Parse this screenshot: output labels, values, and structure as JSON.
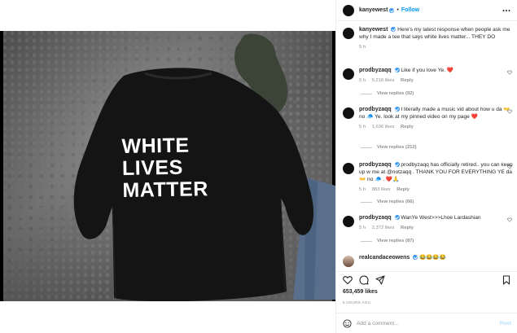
{
  "header": {
    "username": "kanyewest",
    "separator": "•",
    "follow_label": "Follow"
  },
  "shirt_print": [
    "WHITE",
    "LIVES",
    "MATTER"
  ],
  "caption": {
    "username": "kanyewest",
    "text": "Here's my latest response when people ask me why I made a tee that says white lives matter... THEY DO",
    "time": "5 h"
  },
  "comments": [
    {
      "username": "prodbyzaqq",
      "text": "Like if you love Ye. ❤️",
      "time": "5 h",
      "likes": "5,216 likes",
      "reply_label": "Reply",
      "view_replies": "View replies (92)"
    },
    {
      "username": "prodbyzaqq",
      "text": "I literally made a music vid about how u da 👐 no 🧢 Ye. look at my pinned video on my page ❤️",
      "time": "5 h",
      "likes": "1,636 likes",
      "reply_label": "Reply",
      "view_replies": "View replies (212)"
    },
    {
      "username": "prodbyzaqq",
      "text": "prodbyzaqq has officially retired.. you can keep up w me at @notzaqq . THANK YOU FOR EVERYTHING YE da 👐 no 🧢 . ❤️🙏",
      "time": "5 h",
      "likes": "883 likes",
      "reply_label": "Reply",
      "view_replies": "View replies (66)"
    },
    {
      "username": "prodbyzaqq",
      "text": "WanYe West>>>Lhoe Lardashian",
      "time": "5 h",
      "likes": "2,372 likes",
      "reply_label": "Reply",
      "view_replies": "View replies (87)"
    },
    {
      "username": "realcandaceowens",
      "text": "😂😂😂😂"
    }
  ],
  "actions": {
    "likes": "653,459 likes",
    "posted": "5 HOURS AGO"
  },
  "add_comment": {
    "placeholder": "Add a comment...",
    "post_label": "Post"
  },
  "colors": {
    "accent": "#0095f6",
    "verified": "#3897f0",
    "heart": "#ed4956",
    "muted": "#8e8e8e"
  }
}
